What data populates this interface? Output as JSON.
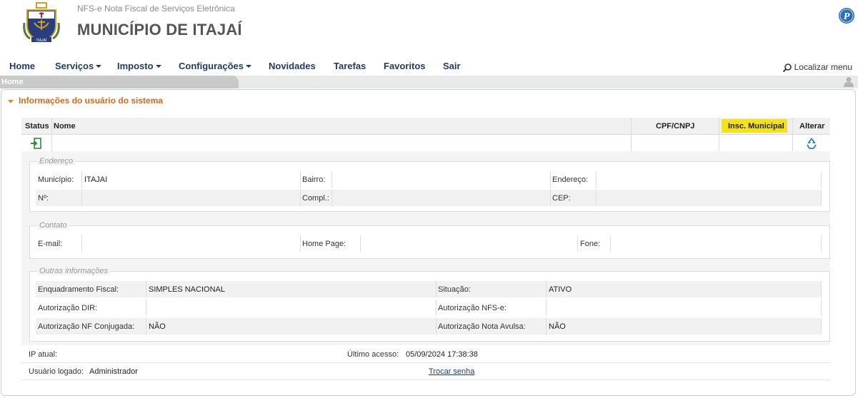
{
  "header": {
    "subtitle": "NFS-e Nota Fiscal de Serviços Eletrônica",
    "title": "MUNICÍPIO DE ITAJAÍ",
    "logo_text": "ITAJAÍ",
    "brand_icon_letter": "P"
  },
  "menu": {
    "items": [
      {
        "label": "Home",
        "dropdown": false
      },
      {
        "label": "Serviços",
        "dropdown": true
      },
      {
        "label": "Imposto",
        "dropdown": true
      },
      {
        "label": "Configurações",
        "dropdown": true
      },
      {
        "label": "Novidades",
        "dropdown": false
      },
      {
        "label": "Tarefas",
        "dropdown": false
      },
      {
        "label": "Favoritos",
        "dropdown": false
      },
      {
        "label": "Sair",
        "dropdown": false
      }
    ],
    "search_label": "Localizar menu"
  },
  "breadcrumb": "Home",
  "panel": {
    "title": "Informações do usuário do sistema",
    "table": {
      "headers": {
        "status": "Status",
        "nome": "Nome",
        "cpf": "CPF/CNPJ",
        "insc": "Insc. Municipal",
        "alterar": "Alterar"
      }
    },
    "endereco": {
      "legend": "Endereço",
      "municipio_label": "Município:",
      "municipio_value": "ITAJAI",
      "bairro_label": "Bairro:",
      "endereco_label": "Endereço:",
      "numero_label": "Nº:",
      "compl_label": "Compl.:",
      "cep_label": "CEP:"
    },
    "contato": {
      "legend": "Contato",
      "email_label": "E-mail:",
      "homepage_label": "Home Page:",
      "fone_label": "Fone:"
    },
    "outras": {
      "legend": "Outras informações",
      "enquadramento_label": "Enquadramento Fiscal:",
      "enquadramento_value": "SIMPLES NACIONAL",
      "situacao_label": "Situação:",
      "situacao_value": "ATIVO",
      "dir_label": "Autorização DIR:",
      "nfse_label": "Autorização NFS-e:",
      "conjugada_label": "Autorização NF Conjugada:",
      "conjugada_value": "NÃO",
      "avulsa_label": "Autorização Nota Avulsa:",
      "avulsa_value": "NÃO"
    },
    "footer": {
      "ip_label": "IP atual:",
      "ultimo_label": "Último acesso:",
      "ultimo_value": "05/09/2024 17:38:38",
      "usuario_label": "Usuário logado:",
      "usuario_value": "Administrador",
      "trocar_senha": "Trocar senha"
    }
  },
  "colors": {
    "accent": "#d2691e",
    "menu": "#1e3a5f",
    "highlight": "#f5e21c"
  }
}
